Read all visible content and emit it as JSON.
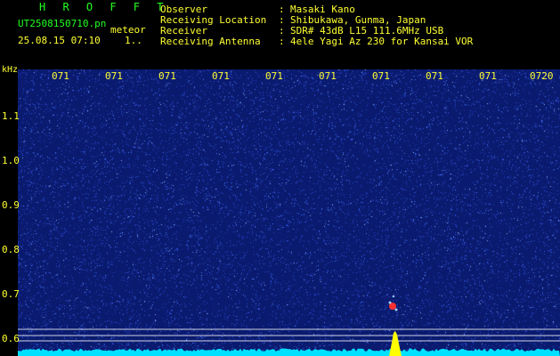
{
  "header": {
    "brand": "HROFFT",
    "file_name": "UT2508150710.pn",
    "mode_label": "meteor",
    "datetime": "25.08.15 07:10",
    "extra": "1.."
  },
  "info": [
    {
      "key": "Observer",
      "value": "Masaki Kano"
    },
    {
      "key": "Receiving Location",
      "value": "Shibukawa, Gunma, Japan"
    },
    {
      "key": "Receiver",
      "value": "SDR# 43dB L15 111.6MHz USB"
    },
    {
      "key": "Receiving Antenna",
      "value": "4ele Yagi Az 230 for Kansai VOR"
    }
  ],
  "axis": {
    "unit_label": "kHz",
    "time_ticks": [
      "071",
      "071",
      "071",
      "071",
      "071",
      "071",
      "071",
      "071",
      "071",
      "0720"
    ],
    "freq_ticks": [
      "1.1",
      "1.0",
      "0.9",
      "0.8",
      "0.7",
      "0.6"
    ]
  },
  "colors": {
    "text": "#ffff33",
    "brand": "#22ff22",
    "background_noise": "#0a1a6e",
    "marker_line": "#ffffff",
    "baseline": "#00e0ff",
    "signal": "#ffff00",
    "echo": "#ff3030"
  }
}
